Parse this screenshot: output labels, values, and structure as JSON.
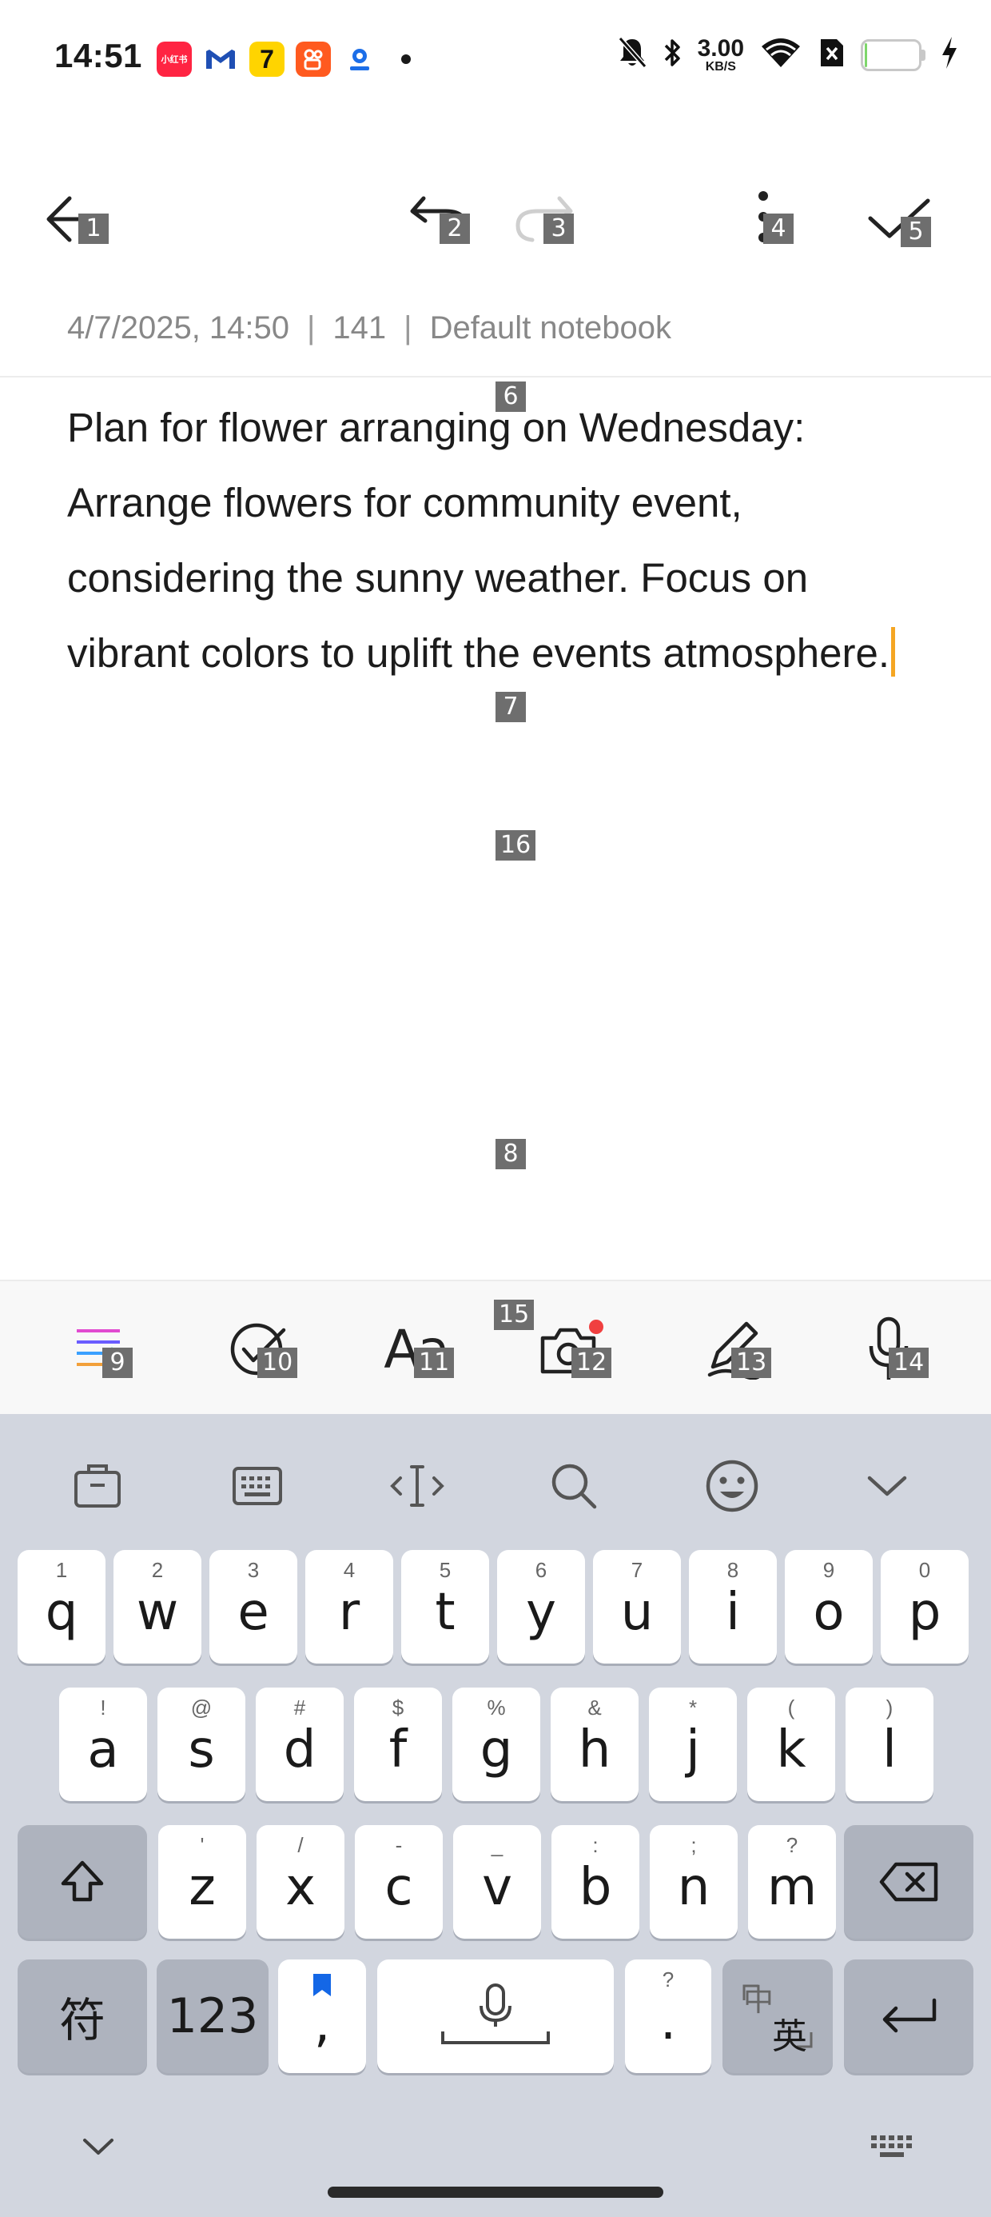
{
  "status_bar": {
    "time": "14:51",
    "net_speed_value": "3.00",
    "net_speed_unit": "KB/S",
    "battery_level": "7",
    "app_icons": [
      {
        "name": "xiaohongshu-icon",
        "text": "小红书",
        "color": "#ff2442"
      },
      {
        "name": "gmail-icon",
        "text": "M",
        "color": "#ffffff"
      },
      {
        "name": "qimao-icon",
        "text": "7",
        "color": "#ffd400"
      },
      {
        "name": "kuaishou-icon",
        "text": "",
        "color": "#ff5a1f"
      },
      {
        "name": "map-app-icon",
        "text": "",
        "color": "#ffffff"
      }
    ]
  },
  "toolbar": {
    "back_icon": "arrow-left-icon",
    "undo_icon": "undo-icon",
    "redo_icon": "redo-icon",
    "more_icon": "more-vertical-icon",
    "done_icon": "check-icon"
  },
  "note": {
    "date": "4/7/2025, 14:50",
    "char_count": "141",
    "notebook": "Default notebook",
    "separator": "|",
    "content": "Plan for flower arranging on Wednesday: Arrange flowers for community event, considering the sunny weather. Focus on vibrant colors to uplift the events atmosphere."
  },
  "tools": [
    {
      "name": "format-list-icon",
      "badge": "9"
    },
    {
      "name": "checklist-icon",
      "badge": "10"
    },
    {
      "name": "text-style-icon",
      "badge": "11",
      "label": "Aa"
    },
    {
      "name": "camera-icon",
      "badge": "12"
    },
    {
      "name": "pen-icon",
      "badge": "13"
    },
    {
      "name": "microphone-icon",
      "badge": "14"
    }
  ],
  "badges": {
    "back": "1",
    "undo": "2",
    "redo": "3",
    "more": "4",
    "done": "5",
    "meta": "6",
    "text": "7",
    "editor": "8",
    "tools_bar": "15",
    "editor_space": "16"
  },
  "keyboard": {
    "row1": [
      {
        "key": "q",
        "sub": "1"
      },
      {
        "key": "w",
        "sub": "2"
      },
      {
        "key": "e",
        "sub": "3"
      },
      {
        "key": "r",
        "sub": "4"
      },
      {
        "key": "t",
        "sub": "5"
      },
      {
        "key": "y",
        "sub": "6"
      },
      {
        "key": "u",
        "sub": "7"
      },
      {
        "key": "i",
        "sub": "8"
      },
      {
        "key": "o",
        "sub": "9"
      },
      {
        "key": "p",
        "sub": "0"
      }
    ],
    "row2": [
      {
        "key": "a",
        "sub": "!"
      },
      {
        "key": "s",
        "sub": "@"
      },
      {
        "key": "d",
        "sub": "#"
      },
      {
        "key": "f",
        "sub": "$"
      },
      {
        "key": "g",
        "sub": "%"
      },
      {
        "key": "h",
        "sub": "&"
      },
      {
        "key": "j",
        "sub": "*"
      },
      {
        "key": "k",
        "sub": "("
      },
      {
        "key": "l",
        "sub": ")"
      }
    ],
    "row3": [
      {
        "key": "z",
        "sub": "'"
      },
      {
        "key": "x",
        "sub": "/"
      },
      {
        "key": "c",
        "sub": "-"
      },
      {
        "key": "v",
        "sub": "_"
      },
      {
        "key": "b",
        "sub": ":"
      },
      {
        "key": "n",
        "sub": ";"
      },
      {
        "key": "m",
        "sub": "?"
      }
    ],
    "symbols_label": "符",
    "numbers_label": "123",
    "comma": ",",
    "period": ".",
    "period_sub": "?",
    "lang_top": "中",
    "lang_bottom": "英"
  }
}
